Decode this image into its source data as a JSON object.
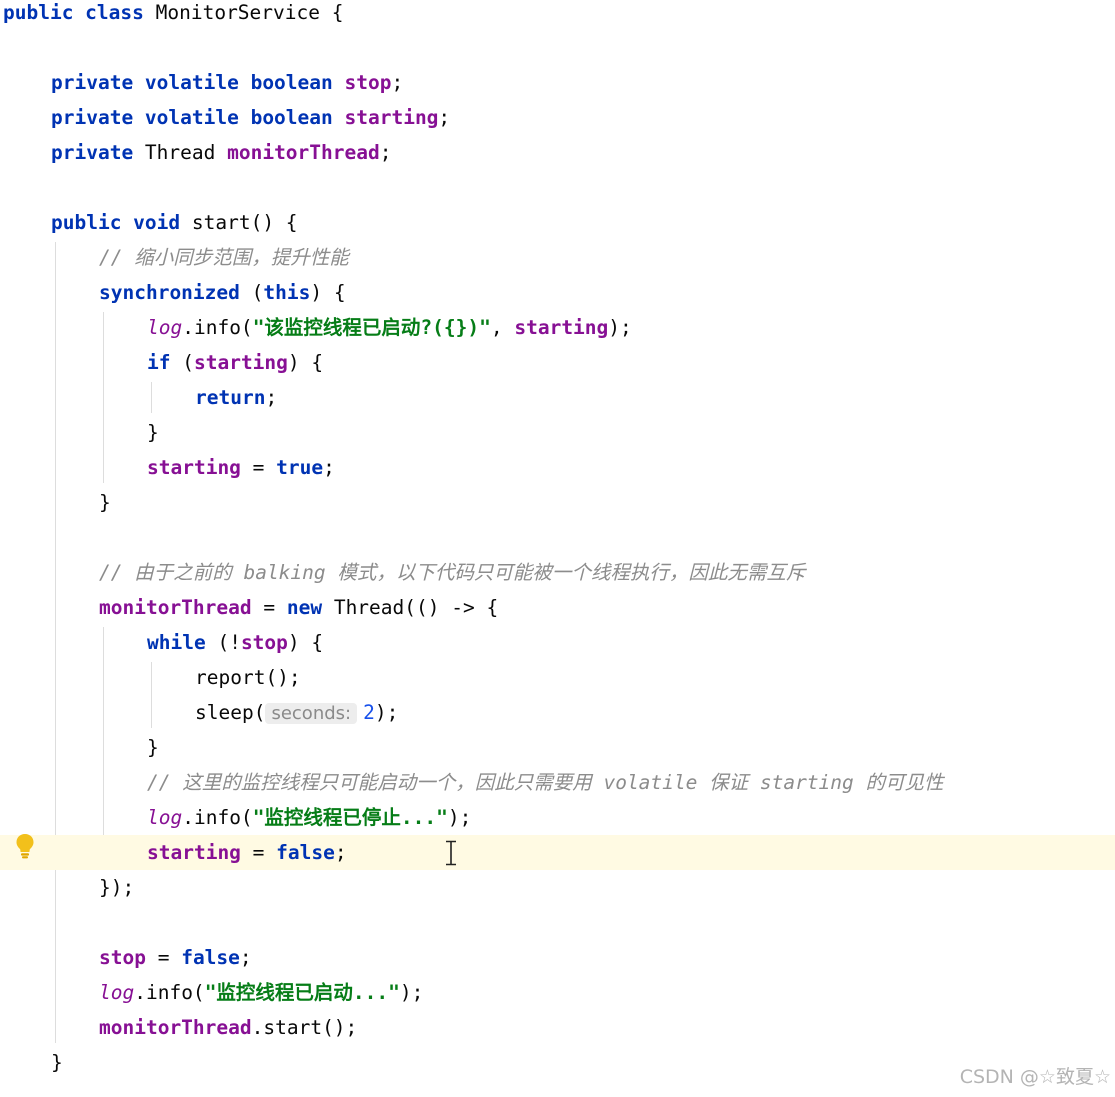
{
  "code": {
    "lines": [
      {
        "n": "1",
        "indent": 0,
        "tokens": [
          {
            "t": "public class ",
            "c": "kw"
          },
          {
            "t": "MonitorService {",
            "c": "plain"
          }
        ]
      },
      {
        "n": "2",
        "indent": 0,
        "tokens": []
      },
      {
        "n": "3",
        "indent": 1,
        "tokens": [
          {
            "t": "private volatile boolean ",
            "c": "kw"
          },
          {
            "t": "stop",
            "c": "field"
          },
          {
            "t": ";",
            "c": "plain"
          }
        ]
      },
      {
        "n": "4",
        "indent": 1,
        "tokens": [
          {
            "t": "private volatile boolean ",
            "c": "kw"
          },
          {
            "t": "starting",
            "c": "field"
          },
          {
            "t": ";",
            "c": "plain"
          }
        ]
      },
      {
        "n": "5",
        "indent": 1,
        "tokens": [
          {
            "t": "private ",
            "c": "kw"
          },
          {
            "t": "Thread ",
            "c": "plain"
          },
          {
            "t": "monitorThread",
            "c": "field"
          },
          {
            "t": ";",
            "c": "plain"
          }
        ]
      },
      {
        "n": "6",
        "indent": 0,
        "tokens": []
      },
      {
        "n": "7",
        "indent": 1,
        "tokens": [
          {
            "t": "public void ",
            "c": "kw"
          },
          {
            "t": "start() {",
            "c": "plain"
          }
        ]
      },
      {
        "n": "8",
        "indent": 2,
        "tokens": [
          {
            "t": "// 缩小同步范围，提升性能",
            "c": "comment"
          }
        ]
      },
      {
        "n": "9",
        "indent": 2,
        "tokens": [
          {
            "t": "synchronized ",
            "c": "kw"
          },
          {
            "t": "(",
            "c": "plain"
          },
          {
            "t": "this",
            "c": "kw"
          },
          {
            "t": ") {",
            "c": "plain"
          }
        ]
      },
      {
        "n": "10",
        "indent": 3,
        "tokens": [
          {
            "t": "log",
            "c": "fieldlog"
          },
          {
            "t": ".info(",
            "c": "plain"
          },
          {
            "t": "\"该监控线程已启动?({})\"",
            "c": "str"
          },
          {
            "t": ", ",
            "c": "plain"
          },
          {
            "t": "starting",
            "c": "field"
          },
          {
            "t": ");",
            "c": "plain"
          }
        ]
      },
      {
        "n": "11",
        "indent": 3,
        "tokens": [
          {
            "t": "if ",
            "c": "kw"
          },
          {
            "t": "(",
            "c": "plain"
          },
          {
            "t": "starting",
            "c": "field"
          },
          {
            "t": ") {",
            "c": "plain"
          }
        ]
      },
      {
        "n": "12",
        "indent": 4,
        "tokens": [
          {
            "t": "return",
            "c": "kw"
          },
          {
            "t": ";",
            "c": "plain"
          }
        ]
      },
      {
        "n": "13",
        "indent": 3,
        "tokens": [
          {
            "t": "}",
            "c": "plain"
          }
        ]
      },
      {
        "n": "14",
        "indent": 3,
        "tokens": [
          {
            "t": "starting",
            "c": "field"
          },
          {
            "t": " = ",
            "c": "plain"
          },
          {
            "t": "true",
            "c": "kw"
          },
          {
            "t": ";",
            "c": "plain"
          }
        ]
      },
      {
        "n": "15",
        "indent": 2,
        "tokens": [
          {
            "t": "}",
            "c": "plain"
          }
        ]
      },
      {
        "n": "16",
        "indent": 0,
        "tokens": []
      },
      {
        "n": "17",
        "indent": 2,
        "tokens": [
          {
            "t": "// 由于之前的 balking 模式，以下代码只可能被一个线程执行，因此无需互斥",
            "c": "comment"
          }
        ]
      },
      {
        "n": "18",
        "indent": 2,
        "tokens": [
          {
            "t": "monitorThread",
            "c": "field"
          },
          {
            "t": " = ",
            "c": "plain"
          },
          {
            "t": "new ",
            "c": "kw"
          },
          {
            "t": "Thread(() -> {",
            "c": "plain"
          }
        ]
      },
      {
        "n": "19",
        "indent": 3,
        "tokens": [
          {
            "t": "while ",
            "c": "kw"
          },
          {
            "t": "(!",
            "c": "plain"
          },
          {
            "t": "stop",
            "c": "field"
          },
          {
            "t": ") {",
            "c": "plain"
          }
        ]
      },
      {
        "n": "20",
        "indent": 4,
        "tokens": [
          {
            "t": "report();",
            "c": "plain"
          }
        ]
      },
      {
        "n": "21",
        "indent": 4,
        "tokens": [
          {
            "t": "sleep(",
            "c": "plain"
          },
          {
            "t": "seconds:",
            "c": "hint"
          },
          {
            "t": "2",
            "c": "num"
          },
          {
            "t": ");",
            "c": "plain"
          }
        ]
      },
      {
        "n": "22",
        "indent": 3,
        "tokens": [
          {
            "t": "}",
            "c": "plain"
          }
        ]
      },
      {
        "n": "23",
        "indent": 3,
        "tokens": [
          {
            "t": "// 这里的监控线程只可能启动一个，因此只需要用 volatile 保证 starting 的可见性",
            "c": "comment"
          }
        ]
      },
      {
        "n": "24",
        "indent": 3,
        "tokens": [
          {
            "t": "log",
            "c": "fieldlog"
          },
          {
            "t": ".info(",
            "c": "plain"
          },
          {
            "t": "\"监控线程已停止...\"",
            "c": "str"
          },
          {
            "t": ");",
            "c": "plain"
          }
        ]
      },
      {
        "n": "25",
        "indent": 3,
        "highlight": true,
        "tokens": [
          {
            "t": "starting",
            "c": "field"
          },
          {
            "t": " = ",
            "c": "plain"
          },
          {
            "t": "false",
            "c": "kw"
          },
          {
            "t": ";",
            "c": "plain"
          }
        ]
      },
      {
        "n": "26",
        "indent": 2,
        "tokens": [
          {
            "t": "});",
            "c": "plain"
          }
        ]
      },
      {
        "n": "27",
        "indent": 0,
        "tokens": []
      },
      {
        "n": "28",
        "indent": 2,
        "tokens": [
          {
            "t": "stop",
            "c": "field"
          },
          {
            "t": " = ",
            "c": "plain"
          },
          {
            "t": "false",
            "c": "kw"
          },
          {
            "t": ";",
            "c": "plain"
          }
        ]
      },
      {
        "n": "29",
        "indent": 2,
        "tokens": [
          {
            "t": "log",
            "c": "fieldlog"
          },
          {
            "t": ".info(",
            "c": "plain"
          },
          {
            "t": "\"监控线程已启动...\"",
            "c": "str"
          },
          {
            "t": ");",
            "c": "plain"
          }
        ]
      },
      {
        "n": "30",
        "indent": 2,
        "tokens": [
          {
            "t": "monitorThread",
            "c": "field"
          },
          {
            "t": ".start();",
            "c": "plain"
          }
        ]
      },
      {
        "n": "31",
        "indent": 1,
        "tokens": [
          {
            "t": "}",
            "c": "plain"
          }
        ]
      }
    ]
  },
  "gutter": {
    "icon": "intention-bulb-icon",
    "icon_color": "#f2c01b"
  },
  "cursor": {
    "icon": "text-cursor-icon"
  },
  "watermark": {
    "text": "CSDN @☆致夏☆"
  },
  "colors": {
    "keyword": "#0033b3",
    "field": "#871094",
    "string": "#067d17",
    "number": "#1750eb",
    "comment": "#8c8c8c",
    "text": "#080808",
    "highlight_line": "#fffae3"
  }
}
